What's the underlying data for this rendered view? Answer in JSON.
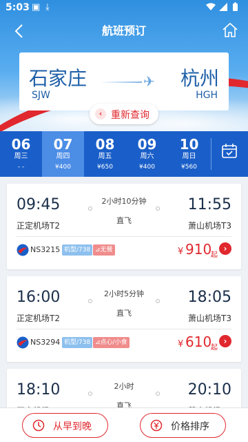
{
  "statusbar": {
    "time": "5:03"
  },
  "titlebar": {
    "title": "航班预订"
  },
  "route": {
    "from_city": "石家庄",
    "from_code": "SJW",
    "to_city": "杭州",
    "to_code": "HGH",
    "requery_label": "重新查询"
  },
  "dates": [
    {
      "day": "06",
      "week": "周三",
      "price": "- -"
    },
    {
      "day": "07",
      "week": "周四",
      "price": "¥400"
    },
    {
      "day": "08",
      "week": "周五",
      "price": "¥650"
    },
    {
      "day": "09",
      "week": "周六",
      "price": "¥400"
    },
    {
      "day": "10",
      "week": "周日",
      "price": "¥560"
    }
  ],
  "flights": [
    {
      "dep_time": "09:45",
      "dep_airport": "正定机场T2",
      "arr_time": "11:55",
      "arr_airport": "萧山机场T3",
      "duration": "2小时10分钟",
      "type": "直飞",
      "flight_no": "NS3215",
      "model_tag": "机型/738",
      "meal_tag": "⊿无餐",
      "price_symbol": "¥",
      "price": "910",
      "price_suffix": "起"
    },
    {
      "dep_time": "16:00",
      "dep_airport": "正定机场T2",
      "arr_time": "18:05",
      "arr_airport": "萧山机场T3",
      "duration": "2小时5分钟",
      "type": "直飞",
      "flight_no": "NS3294",
      "model_tag": "机型/738",
      "meal_tag": "⊿点心/小食",
      "price_symbol": "¥",
      "price": "610",
      "price_suffix": "起"
    },
    {
      "dep_time": "18:10",
      "dep_airport": "正定机场T2",
      "arr_time": "20:10",
      "arr_airport": "萧山机场T3",
      "duration": "2小时",
      "type": "直飞"
    }
  ],
  "bottom": {
    "early_label": "从早到晚",
    "price_label": "价格排序"
  },
  "colors": {
    "brand_red": "#e0282e",
    "brand_blue": "#1a5fc9",
    "active_date": "#4c8de6"
  }
}
